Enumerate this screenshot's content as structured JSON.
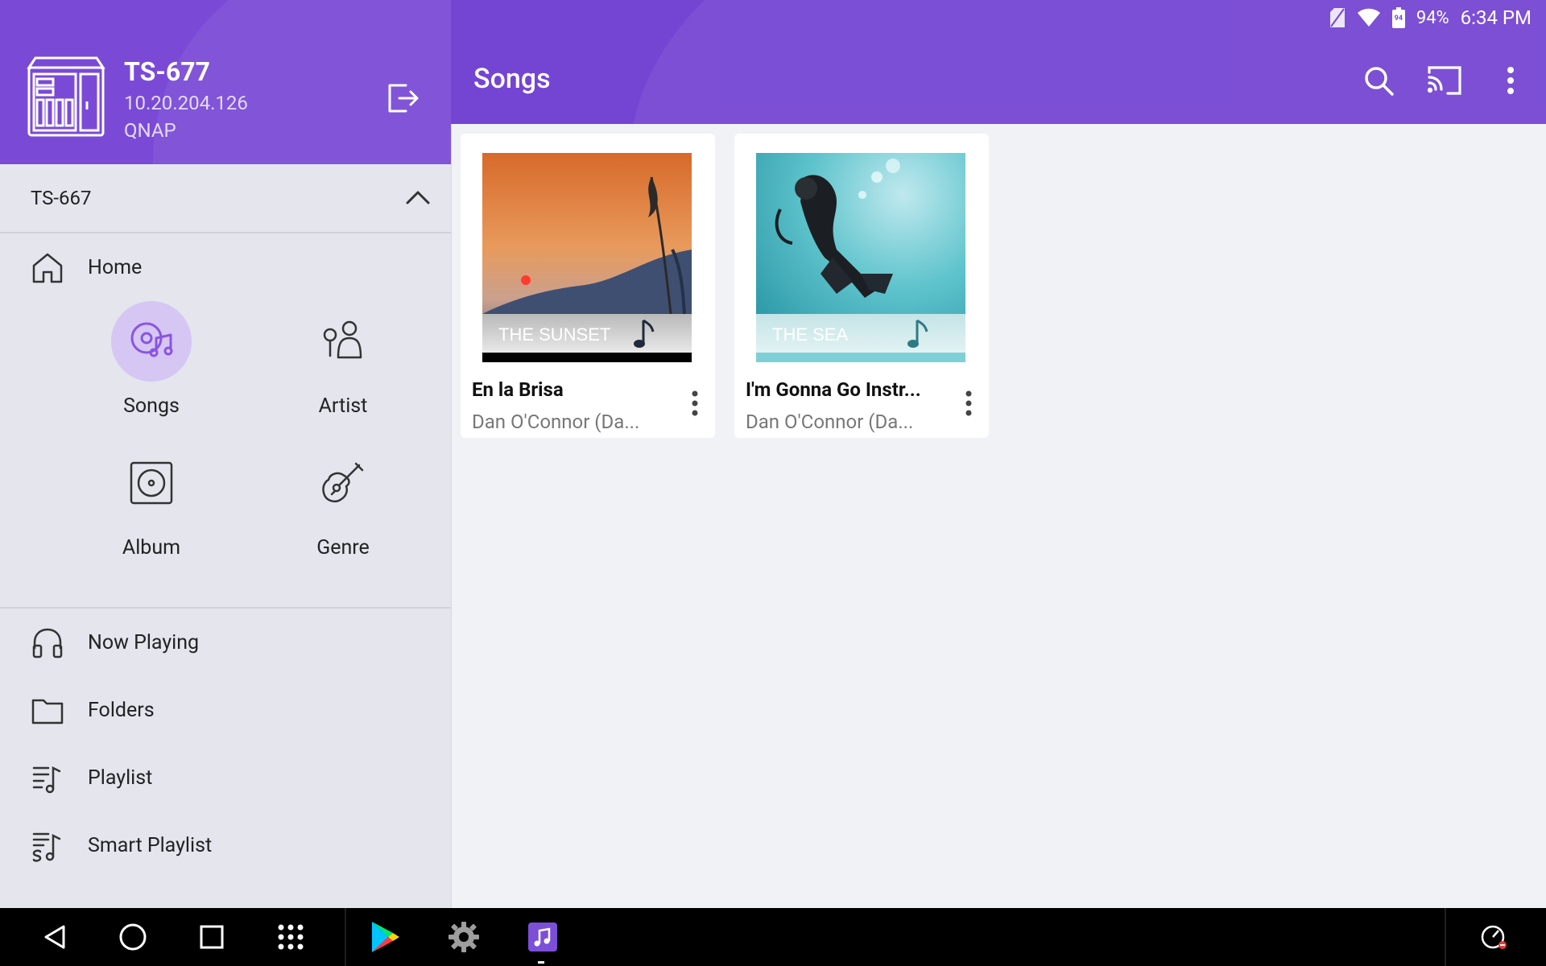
{
  "status_bar": {
    "battery": "94%",
    "battery_badge": "94",
    "time": "6:34 PM"
  },
  "device": {
    "name": "TS-677",
    "ip": "10.20.204.126",
    "brand": "QNAP"
  },
  "server_selector": {
    "label": "TS-667"
  },
  "header": {
    "title": "Songs"
  },
  "sidebar": {
    "home": "Home",
    "categories": [
      {
        "label": "Songs",
        "icon": "songs-icon",
        "active": true
      },
      {
        "label": "Artist",
        "icon": "artist-icon"
      },
      {
        "label": "Album",
        "icon": "album-icon"
      },
      {
        "label": "Genre",
        "icon": "genre-icon"
      }
    ],
    "items": [
      {
        "label": "Now Playing",
        "icon": "headphones-icon"
      },
      {
        "label": "Folders",
        "icon": "folder-icon"
      },
      {
        "label": "Playlist",
        "icon": "playlist-icon"
      },
      {
        "label": "Smart Playlist",
        "icon": "smart-playlist-icon"
      }
    ]
  },
  "songs": [
    {
      "title": "En la Brisa",
      "artist": "Dan O'Connor (Da...",
      "cover_text": "THE SUNSET"
    },
    {
      "title": "I'm Gonna Go Instr...",
      "artist": "Dan O'Connor (Da...",
      "cover_text": "THE SEA"
    }
  ],
  "colors": {
    "accent": "#7445d3",
    "active_bubble": "#d5c6f3"
  }
}
